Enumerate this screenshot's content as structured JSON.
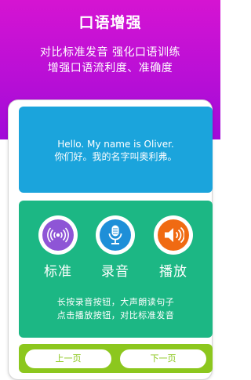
{
  "header": {
    "title": "口语增强",
    "subtitle_line1": "对比标准发音 强化口语训练",
    "subtitle_line2": "增强口语流利度、准确度"
  },
  "sentence": {
    "english": "Hello. My name is Oliver.",
    "chinese": "你们好。我的名字叫奥利弗。"
  },
  "controls": {
    "standard_label": "标准",
    "record_label": "录音",
    "play_label": "播放",
    "hint_line1": "长按录音按钮，大声朗读句子",
    "hint_line2": "点击播放按钮，对比标准发音"
  },
  "nav": {
    "prev_label": "上一页",
    "next_label": "下一页"
  },
  "colors": {
    "header": "#c011d6",
    "sentence_box": "#1ba4dc",
    "controls_box": "#1cb784",
    "nav_bar": "#8cc71e",
    "standard": "#8e55d6",
    "record": "#1e8fd8",
    "play": "#f06a12"
  },
  "icons": {
    "standard": "sound-wave-icon",
    "record": "microphone-icon",
    "play": "speaker-icon"
  }
}
